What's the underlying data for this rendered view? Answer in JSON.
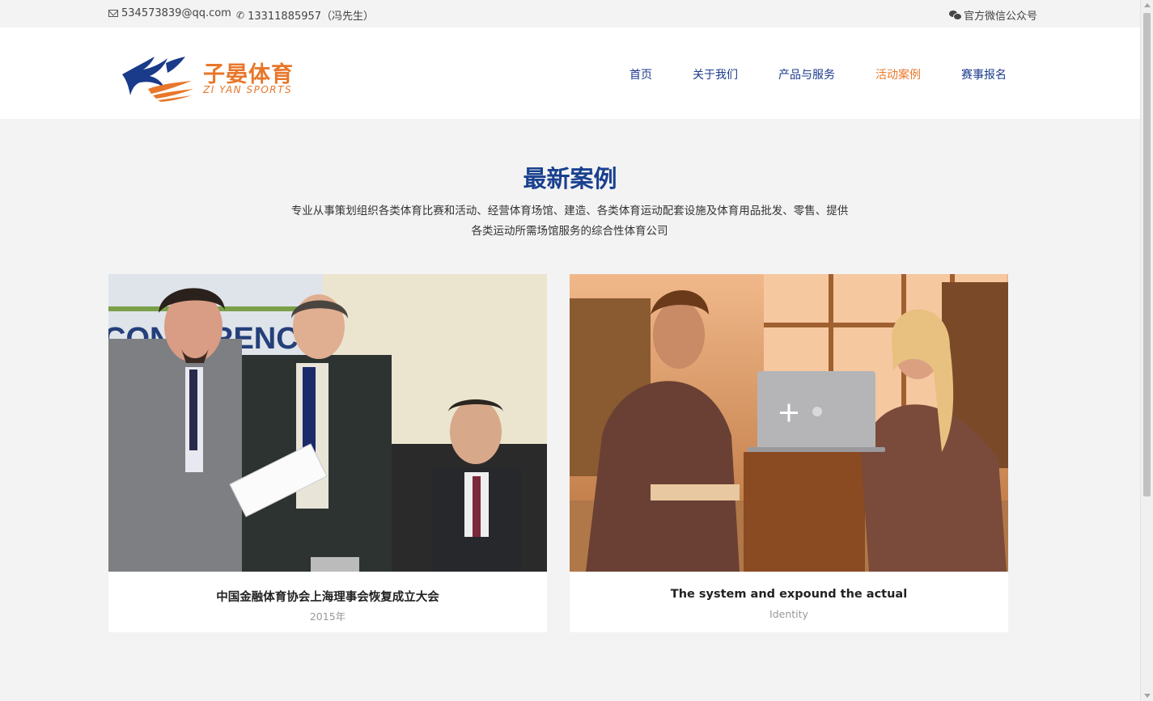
{
  "topbar": {
    "email": "534573839@qq.com",
    "phone": "13311885957（冯先生）",
    "wechat_label": "官方微信公众号"
  },
  "logo": {
    "name_cn": "子晏体育",
    "name_en": "ZI YAN SPORTS"
  },
  "nav": [
    {
      "label": "首页",
      "active": false
    },
    {
      "label": "关于我们",
      "active": false
    },
    {
      "label": "产品与服务",
      "active": false
    },
    {
      "label": "活动案例",
      "active": true
    },
    {
      "label": "赛事报名",
      "active": false
    }
  ],
  "section": {
    "title": "最新案例",
    "desc_line1": "专业从事策划组织各类体育比赛和活动、经营体育场馆、建造、各类体育运动配套设施及体育用品批发、零售、提供",
    "desc_line2": "各类运动所需场馆服务的综合性体育公司"
  },
  "cards": [
    {
      "title": "中国金融体育协会上海理事会恢复成立大会",
      "subtitle": "2015年",
      "banner_text": "CONFERENCE"
    },
    {
      "title": "The system and expound the actual",
      "subtitle": "Identity",
      "overlay_icon": "+"
    }
  ],
  "colors": {
    "brand_blue": "#1a4190",
    "brand_orange": "#e8772a",
    "nav_text": "#1a3a8a"
  },
  "icons": [
    "mail-icon",
    "phone-icon",
    "wechat-icon",
    "plus-icon"
  ]
}
